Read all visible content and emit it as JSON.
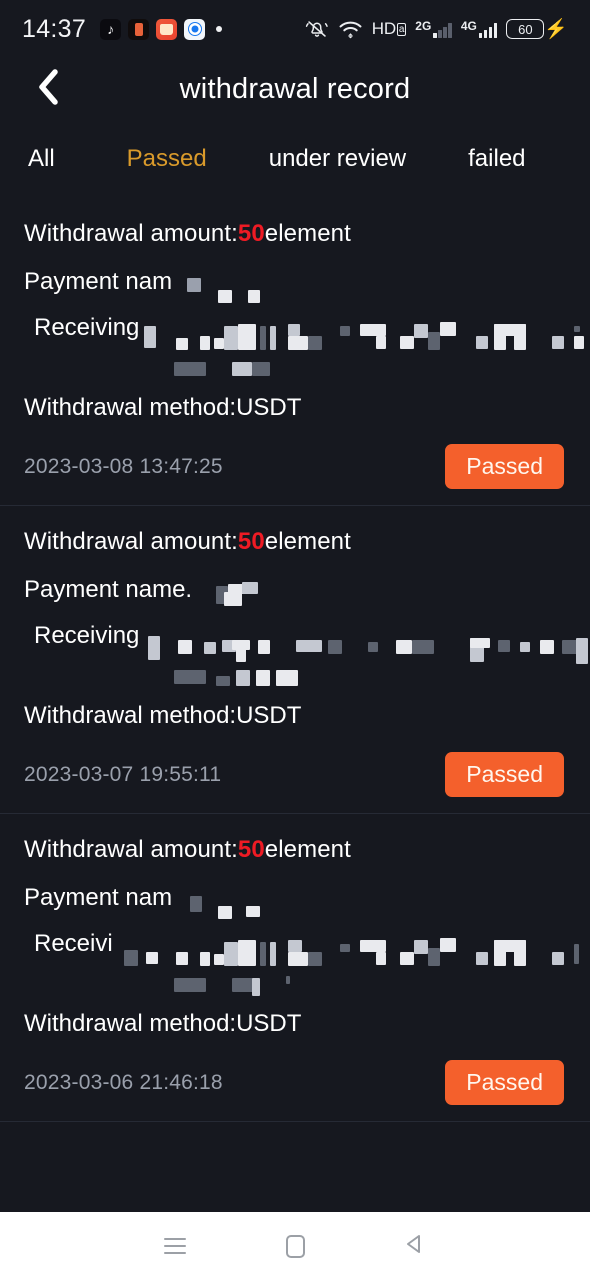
{
  "theme": {
    "background": "#16181f",
    "accent_orange": "#f4602c",
    "accent_amber": "#d99a2b",
    "amount_red": "#ee1b24",
    "divider": "#262a35",
    "muted_text": "#9aa0ac"
  },
  "statusbar": {
    "clock": "14:37",
    "app_icons": [
      "tiktok-icon",
      "notes-app-icon",
      "camera-app-icon",
      "browser-app-icon",
      "notification-dot"
    ],
    "right_icons": [
      "mute-bell-icon",
      "wifi-icon"
    ],
    "hd_label": "HD",
    "hd_badge": "a",
    "network_2g": "2G",
    "network_4g": "4G",
    "battery_level": "60",
    "charging": "charging-bolt-icon"
  },
  "header": {
    "back_icon": "chevron-left-icon",
    "title": "withdrawal record"
  },
  "tabs": [
    {
      "label": "All",
      "active": false
    },
    {
      "label": "Passed",
      "active": true
    },
    {
      "label": "under review",
      "active": false
    },
    {
      "label": "failed",
      "active": false
    }
  ],
  "labels": {
    "amount_prefix": "Withdrawal amount:",
    "amount_suffix": "element",
    "payment_name_1": "Payment nam",
    "payment_name_2": "Payment name.",
    "payment_name_3": "Payment nam",
    "receiving_1": "Receiving",
    "receiving_2": "Receiving",
    "receiving_3": "Receivi",
    "method_prefix": "Withdrawal method:"
  },
  "records": [
    {
      "amount": "50",
      "method": "USDT",
      "timestamp": "2023-03-08 13:47:25",
      "status": "Passed",
      "payment_name_value": "redacted",
      "receiving_address_value": "redacted"
    },
    {
      "amount": "50",
      "method": "USDT",
      "timestamp": "2023-03-07 19:55:11",
      "status": "Passed",
      "payment_name_value": "redacted",
      "receiving_address_value": "redacted"
    },
    {
      "amount": "50",
      "method": "USDT",
      "timestamp": "2023-03-06 21:46:18",
      "status": "Passed",
      "payment_name_value": "redacted",
      "receiving_address_value": "redacted"
    }
  ],
  "navbar": {
    "recents": "recents-icon",
    "home": "home-icon",
    "back": "back-triangle-icon"
  }
}
